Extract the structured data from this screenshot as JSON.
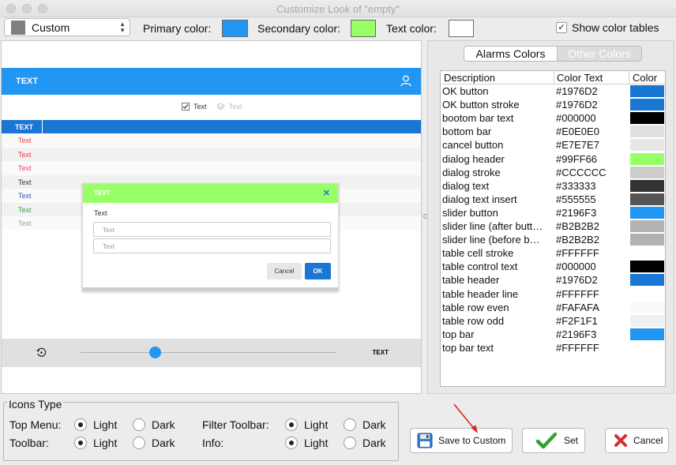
{
  "window": {
    "title": "Customize Look of \"empty\""
  },
  "toolbar": {
    "preset": "Custom",
    "primary_label": "Primary color:",
    "primary_color": "#2196F3",
    "secondary_label": "Secondary color:",
    "secondary_color": "#99FF66",
    "text_label": "Text color:",
    "text_color": "#FFFFFF",
    "show_tables_label": "Show color tables",
    "show_tables_checked": true
  },
  "preview": {
    "top_bar_text": "TEXT",
    "filter_items": [
      "Text",
      "Text"
    ],
    "table_header_text": "TEXT",
    "table_rows": [
      {
        "text": "Text",
        "color": "#e53935"
      },
      {
        "text": "Text",
        "color": "#e53935"
      },
      {
        "text": "Text",
        "color": "#ec407a"
      },
      {
        "text": "Text",
        "color": "#333333"
      },
      {
        "text": "Text",
        "color": "#3f51b5"
      },
      {
        "text": "Text",
        "color": "#43a047"
      },
      {
        "text": "Text",
        "color": "#9e9e9e"
      }
    ],
    "dialog": {
      "title": "TEXT",
      "close_icon": "close-icon",
      "text": "Text",
      "input1_placeholder": "Text",
      "input2_placeholder": "Text",
      "cancel_label": "Cancel",
      "ok_label": "OK"
    },
    "bottom_bar_text": "TEXT",
    "slider_value": 0.28
  },
  "color_table": {
    "tabs": [
      "Alarms Colors",
      "Other Colors"
    ],
    "active_tab": 0,
    "headers": [
      "Description",
      "Color Text",
      "Color"
    ],
    "rows": [
      {
        "description": "OK button",
        "hex": "#1976D2"
      },
      {
        "description": "OK button stroke",
        "hex": "#1976D2"
      },
      {
        "description": "bootom bar text",
        "hex": "#000000"
      },
      {
        "description": "bottom bar",
        "hex": "#E0E0E0"
      },
      {
        "description": "cancel button",
        "hex": "#E7E7E7"
      },
      {
        "description": "dialog header",
        "hex": "#99FF66"
      },
      {
        "description": "dialog stroke",
        "hex": "#CCCCCC"
      },
      {
        "description": "dialog text",
        "hex": "#333333"
      },
      {
        "description": "dialog text insert",
        "hex": "#555555"
      },
      {
        "description": "slider button",
        "hex": "#2196F3"
      },
      {
        "description": "slider line (after butt…",
        "hex": "#B2B2B2"
      },
      {
        "description": "slider line (before b…",
        "hex": "#B2B2B2"
      },
      {
        "description": "table cell stroke",
        "hex": "#FFFFFF"
      },
      {
        "description": "table control text",
        "hex": "#000000"
      },
      {
        "description": "table header",
        "hex": "#1976D2"
      },
      {
        "description": "table header line",
        "hex": "#FFFFFF"
      },
      {
        "description": "table row even",
        "hex": "#FAFAFA"
      },
      {
        "description": "table row odd",
        "hex": "#F2F1F1"
      },
      {
        "description": "top bar",
        "hex": "#2196F3"
      },
      {
        "description": "top bar text",
        "hex": "#FFFFFF"
      }
    ]
  },
  "icons_type": {
    "legend": "Icons Type",
    "top_menu_label": "Top Menu:",
    "toolbar_label": "Toolbar:",
    "filter_toolbar_label": "Filter Toolbar:",
    "info_label": "Info:",
    "light_label": "Light",
    "dark_label": "Dark",
    "selected": {
      "top_menu": "Light",
      "toolbar": "Light",
      "filter_toolbar": "Light",
      "info": "Light"
    }
  },
  "buttons": {
    "save_custom": "Save to Custom",
    "set": "Set",
    "cancel": "Cancel"
  }
}
